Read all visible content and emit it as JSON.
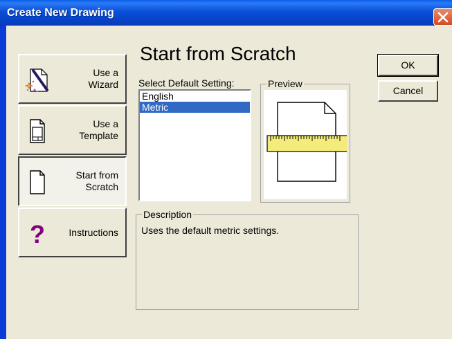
{
  "window": {
    "title": "Create New Drawing"
  },
  "modes": [
    {
      "label": "Use a\nWizard",
      "icon": "wizard-wand-icon",
      "pressed": false
    },
    {
      "label": "Use a\nTemplate",
      "icon": "template-document-icon",
      "pressed": false
    },
    {
      "label": "Start from\nScratch",
      "icon": "blank-document-icon",
      "pressed": true
    },
    {
      "label": "Instructions",
      "icon": "question-mark-icon",
      "pressed": false
    }
  ],
  "main": {
    "heading": "Start from Scratch",
    "select_label": "Select Default Setting:",
    "settings": [
      {
        "label": "English",
        "selected": false
      },
      {
        "label": "Metric",
        "selected": true
      }
    ],
    "preview_label": "Preview",
    "description_label": "Description",
    "description_text": "Uses the default metric settings."
  },
  "buttons": {
    "ok": "OK",
    "cancel": "Cancel"
  },
  "colors": {
    "titlebar": "#0a4fd8",
    "selection": "#316ac5",
    "face": "#ece9d8",
    "ruler": "#f4ec7a"
  }
}
